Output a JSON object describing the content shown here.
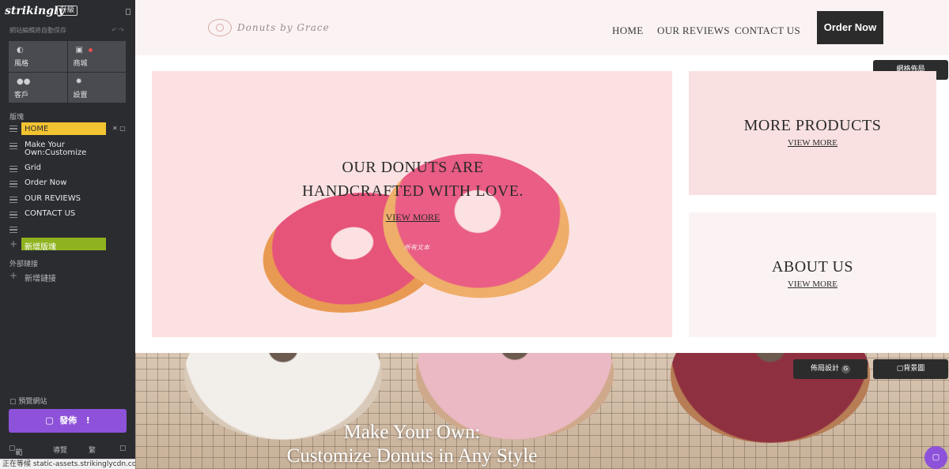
{
  "editor": {
    "brand": "strikingly",
    "upgrade": "升級",
    "autosave": "網站編輯將自動保存",
    "tiles": [
      {
        "label": "風格",
        "icon": "palette-icon"
      },
      {
        "label": "商城",
        "icon": "shop-bag-icon"
      },
      {
        "label": "客戶",
        "icon": "people-icon"
      },
      {
        "label": "設置",
        "icon": "gear-icon"
      }
    ],
    "sections_label": "版塊",
    "nav": [
      {
        "label": "HOME",
        "active": true
      },
      {
        "label": "Make Your Own:Customize",
        "active": false
      },
      {
        "label": "Grid",
        "active": false
      },
      {
        "label": "Order Now",
        "active": false
      },
      {
        "label": "OUR REVIEWS",
        "active": false
      },
      {
        "label": "CONTACT US",
        "active": false
      }
    ],
    "add_section": "新增版塊",
    "external_links_label": "外部鏈接",
    "add_link": "新增鏈接",
    "preview": "預覽網站",
    "publish": "發佈",
    "bottom": {
      "help": "範問",
      "guide": "導覽",
      "lang": "繁"
    },
    "status": "正在等候 static-assets.strikinglycdn.com..."
  },
  "site": {
    "logo_text": "Donuts by Grace",
    "menu": [
      "HOME",
      "OUR REVIEWS",
      "CONTACT US"
    ],
    "order_button": "Order Now",
    "grid_layout_button": "網格佈局",
    "hero": {
      "title_line1": "OUR DONUTS ARE",
      "title_line2": "HANDCRAFTED WITH LOVE.",
      "link": "VIEW MORE",
      "caption": "所有文本"
    },
    "card_products": {
      "title": "MORE PRODUCTS",
      "link": "VIEW MORE"
    },
    "card_about": {
      "title": "ABOUT US",
      "link": "VIEW MORE"
    },
    "banner": {
      "line1": "Make Your Own:",
      "line2": "Customize Donuts in Any Style"
    },
    "layout_design_button": "佈局設計",
    "layout_design_badge": "G",
    "background_button": "背景圖"
  },
  "colors": {
    "sidebar": "#2b2c30",
    "active_nav": "#f3c431",
    "add_section": "#8fb31f",
    "publish": "#8d52d9",
    "hero_bg": "#fbe1e1",
    "header_bg": "#fbf3f3"
  }
}
